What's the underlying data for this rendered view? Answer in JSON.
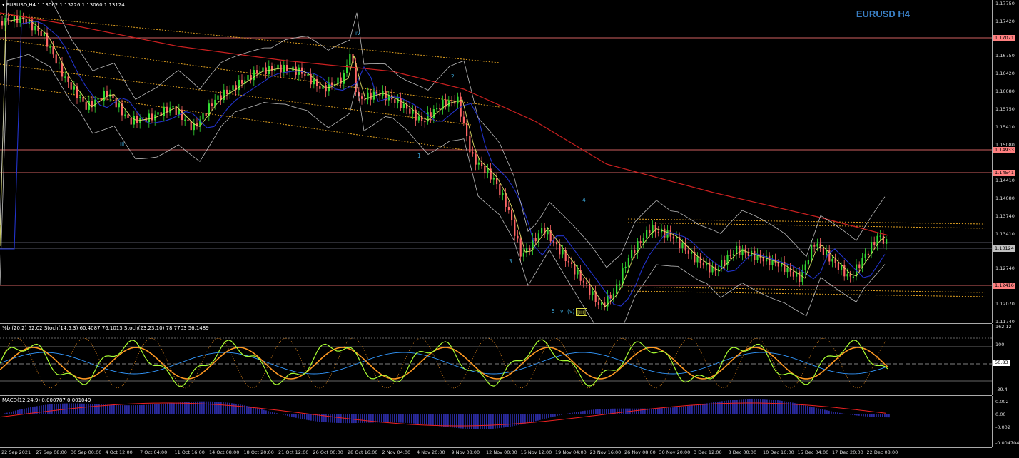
{
  "main": {
    "title": "EURUSD,H4  1.13062 1.13226 1.13060 1.13124",
    "symbol_tag": "EURUSD H4",
    "price_labels": [
      "1.17750",
      "1.17420",
      "1.16750",
      "1.16420",
      "1.16080",
      "1.15750",
      "1.15410",
      "1.15080",
      "1.14410",
      "1.14080",
      "1.13740",
      "1.13410",
      "1.12740",
      "1.12070",
      "1.11740"
    ],
    "badges": [
      {
        "text": "1.17071",
        "color": "#ff8080"
      },
      {
        "text": "1.14933",
        "color": "#ff8080"
      },
      {
        "text": "1.14541",
        "color": "#ff8080"
      },
      {
        "text": "1.13124",
        "color": "#c0c0c0"
      },
      {
        "text": "1.12416",
        "color": "#ff8080"
      }
    ],
    "wave_labels": [
      "iii",
      "iv",
      "1",
      "2",
      "3",
      "4",
      "5",
      "v",
      "(v)",
      "[iii]"
    ]
  },
  "stoch": {
    "title": "%b (20,2) 52.02  Stoch(14,5,3) 60.4087 76.1013  Stoch(23,23,10) 78.7703 56.1489",
    "labels": [
      "162.12",
      "100",
      "50.83",
      "-39.4"
    ],
    "right_marks": [
      "80",
      "20"
    ]
  },
  "macd": {
    "title": "MACD(12,24,9) 0.000787 0.001049",
    "labels": [
      "0.002",
      "0.00",
      "-0.002",
      "-0.004704"
    ]
  },
  "xaxis": [
    "22 Sep 2021",
    "27 Sep 08:00",
    "30 Sep 00:00",
    "4 Oct 12:00",
    "7 Oct 04:00",
    "11 Oct 16:00",
    "14 Oct 08:00",
    "18 Oct 20:00",
    "21 Oct 12:00",
    "26 Oct 00:00",
    "28 Oct 16:00",
    "2 Nov 04:00",
    "4 Nov 20:00",
    "9 Nov 08:00",
    "12 Nov 00:00",
    "16 Nov 12:00",
    "19 Nov 04:00",
    "23 Nov 16:00",
    "26 Nov 08:00",
    "30 Nov 20:00",
    "3 Dec 12:00",
    "8 Dec 00:00",
    "10 Dec 16:00",
    "15 Dec 04:00",
    "17 Dec 20:00",
    "22 Dec 08:00"
  ],
  "colors": {
    "bull": "#33dd33",
    "bear": "#ff6666",
    "ma_long": "#cc2020",
    "ma_mid": "#2233cc",
    "ma_fast": "#dddd66",
    "bands": "#bbbbbb",
    "channel": "#e0a020",
    "hline": "#d06060",
    "wave": "#3aa0d0",
    "stoch_main": "#aaff33",
    "stoch_slow": "#ff9922",
    "macd_hist": "#2a2aa0",
    "macd_signal": "#ee2222"
  }
}
